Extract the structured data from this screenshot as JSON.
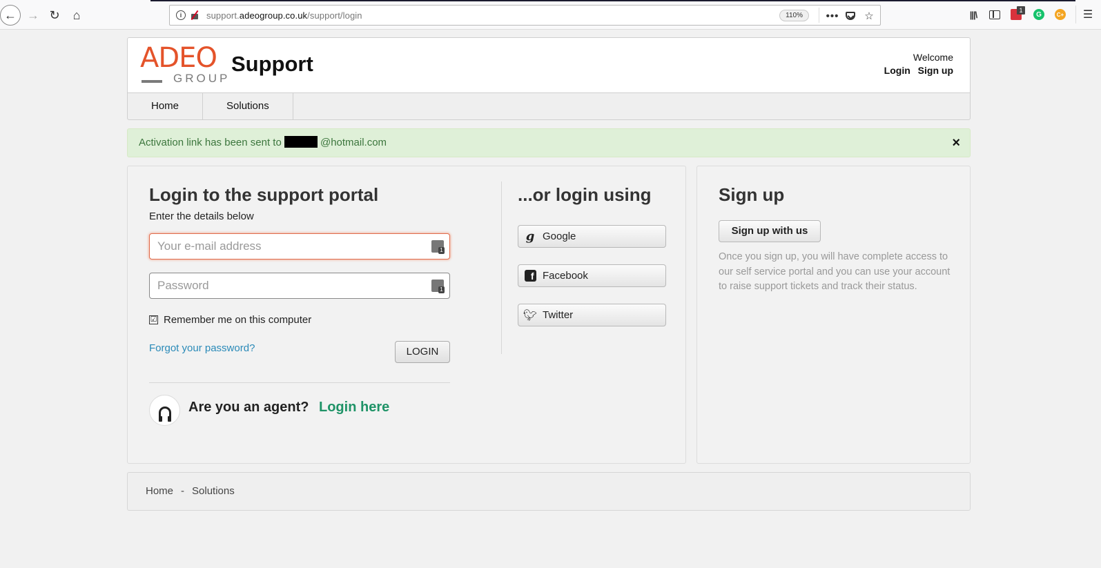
{
  "browser": {
    "url_domain_prefix": "support.",
    "url_domain": "adeogroup.co.uk",
    "url_path": "/support/login",
    "zoom": "110%",
    "more_label": "•••",
    "ext_badge": "1",
    "ext_green_label": "G",
    "ext_orange_label": "C+"
  },
  "header": {
    "logo_word": "ADEO",
    "logo_group": "GROUP",
    "site_title": "Support",
    "welcome": "Welcome",
    "login_link": "Login",
    "signup_link": "Sign up"
  },
  "nav": {
    "items": [
      {
        "label": "Home"
      },
      {
        "label": "Solutions"
      }
    ]
  },
  "alert": {
    "text_before": "Activation link has been sent to",
    "text_after": "@hotmail.com",
    "close": "×"
  },
  "login": {
    "title": "Login to the support portal",
    "subtitle": "Enter the details below",
    "email_placeholder": "Your e-mail address",
    "password_placeholder": "Password",
    "remember_label": "Remember me on this computer",
    "remember_checked": "☑",
    "forgot_label": "Forgot your password?",
    "login_button": "LOGIN",
    "agent_question": "Are you an agent?",
    "agent_link": "Login here"
  },
  "social": {
    "title": "...or login using",
    "buttons": [
      {
        "label": "Google",
        "icon": "google-icon"
      },
      {
        "label": "Facebook",
        "icon": "facebook-icon"
      },
      {
        "label": "Twitter",
        "icon": "twitter-icon"
      }
    ]
  },
  "signup": {
    "title": "Sign up",
    "button": "Sign up with us",
    "description": "Once you sign up, you will have complete access to our self service portal and you can use your account to raise support tickets and track their status."
  },
  "footer": {
    "links": [
      {
        "label": "Home"
      },
      {
        "label": "Solutions"
      }
    ],
    "separator": "-"
  },
  "colors": {
    "brand_orange": "#e4532a",
    "alert_green_bg": "#dff0d8",
    "alert_green_text": "#3c763d",
    "agent_link_green": "#1f9367",
    "link_blue": "#2a8ab8"
  }
}
